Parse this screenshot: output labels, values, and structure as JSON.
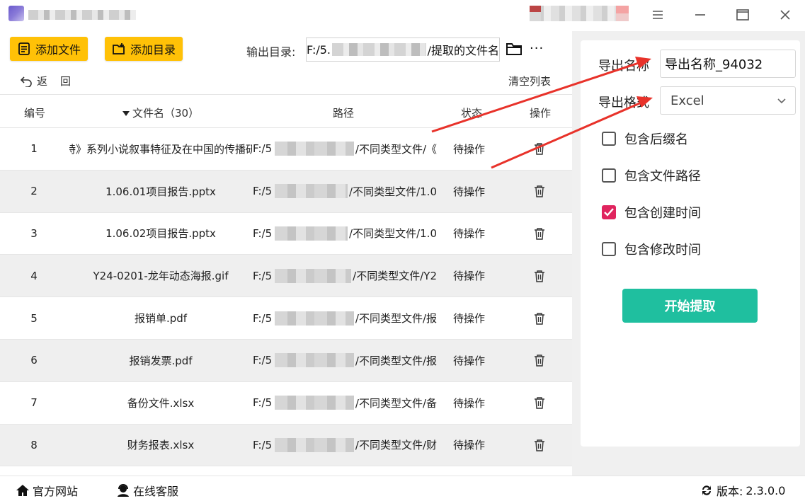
{
  "colors": {
    "accent_yellow": "#ffc107",
    "start_button": "#1fbf9f",
    "checkbox_on": "#e0245e",
    "annotation_arrow": "#e8322a"
  },
  "toolbar": {
    "add_file_label": "添加文件",
    "add_dir_label": "添加目录",
    "output_dir_label": "输出目录:",
    "output_dir_prefix": "F:/5.",
    "output_dir_suffix": "/提取的文件名",
    "more_label": "···"
  },
  "nav": {
    "back_label": "返回",
    "clear_list_label": "清空列表"
  },
  "table": {
    "headers": {
      "num": "编号",
      "filename": "文件名（30）",
      "path": "路径",
      "status": "状态",
      "op": "操作"
    },
    "rows": [
      {
        "num": "1",
        "name": "特》系列小说叙事特征及在中国的传播研",
        "path_prefix": "F:/5",
        "path_suffix": "/不同类型文件/《",
        "status": "待操作"
      },
      {
        "num": "2",
        "name": "1.06.01项目报告.pptx",
        "path_prefix": "F:/5",
        "path_suffix": "/不同类型文件/1.0",
        "status": "待操作"
      },
      {
        "num": "3",
        "name": "1.06.02项目报告.pptx",
        "path_prefix": "F:/5",
        "path_suffix": "/不同类型文件/1.0",
        "status": "待操作"
      },
      {
        "num": "4",
        "name": "Y24-0201-龙年动态海报.gif",
        "path_prefix": "F:/5",
        "path_suffix": "/不同类型文件/Y2",
        "status": "待操作"
      },
      {
        "num": "5",
        "name": "报销单.pdf",
        "path_prefix": "F:/5",
        "path_suffix": "/不同类型文件/报",
        "status": "待操作"
      },
      {
        "num": "6",
        "name": "报销发票.pdf",
        "path_prefix": "F:/5",
        "path_suffix": "/不同类型文件/报",
        "status": "待操作"
      },
      {
        "num": "7",
        "name": "备份文件.xlsx",
        "path_prefix": "F:/5",
        "path_suffix": "/不同类型文件/备",
        "status": "待操作"
      },
      {
        "num": "8",
        "name": "财务报表.xlsx",
        "path_prefix": "F:/5",
        "path_suffix": "/不同类型文件/财",
        "status": "待操作"
      }
    ]
  },
  "panel": {
    "export_name_label": "导出名称",
    "export_name_value": "导出名称_94032",
    "export_format_label": "导出格式",
    "export_format_value": "Excel",
    "options": [
      {
        "label": "包含后缀名",
        "checked": false
      },
      {
        "label": "包含文件路径",
        "checked": false
      },
      {
        "label": "包含创建时间",
        "checked": true
      },
      {
        "label": "包含修改时间",
        "checked": false
      }
    ],
    "start_label": "开始提取"
  },
  "footer": {
    "website_label": "官方网站",
    "support_label": "在线客服",
    "version_label": "版本:",
    "version_value": "2.3.0.0"
  }
}
